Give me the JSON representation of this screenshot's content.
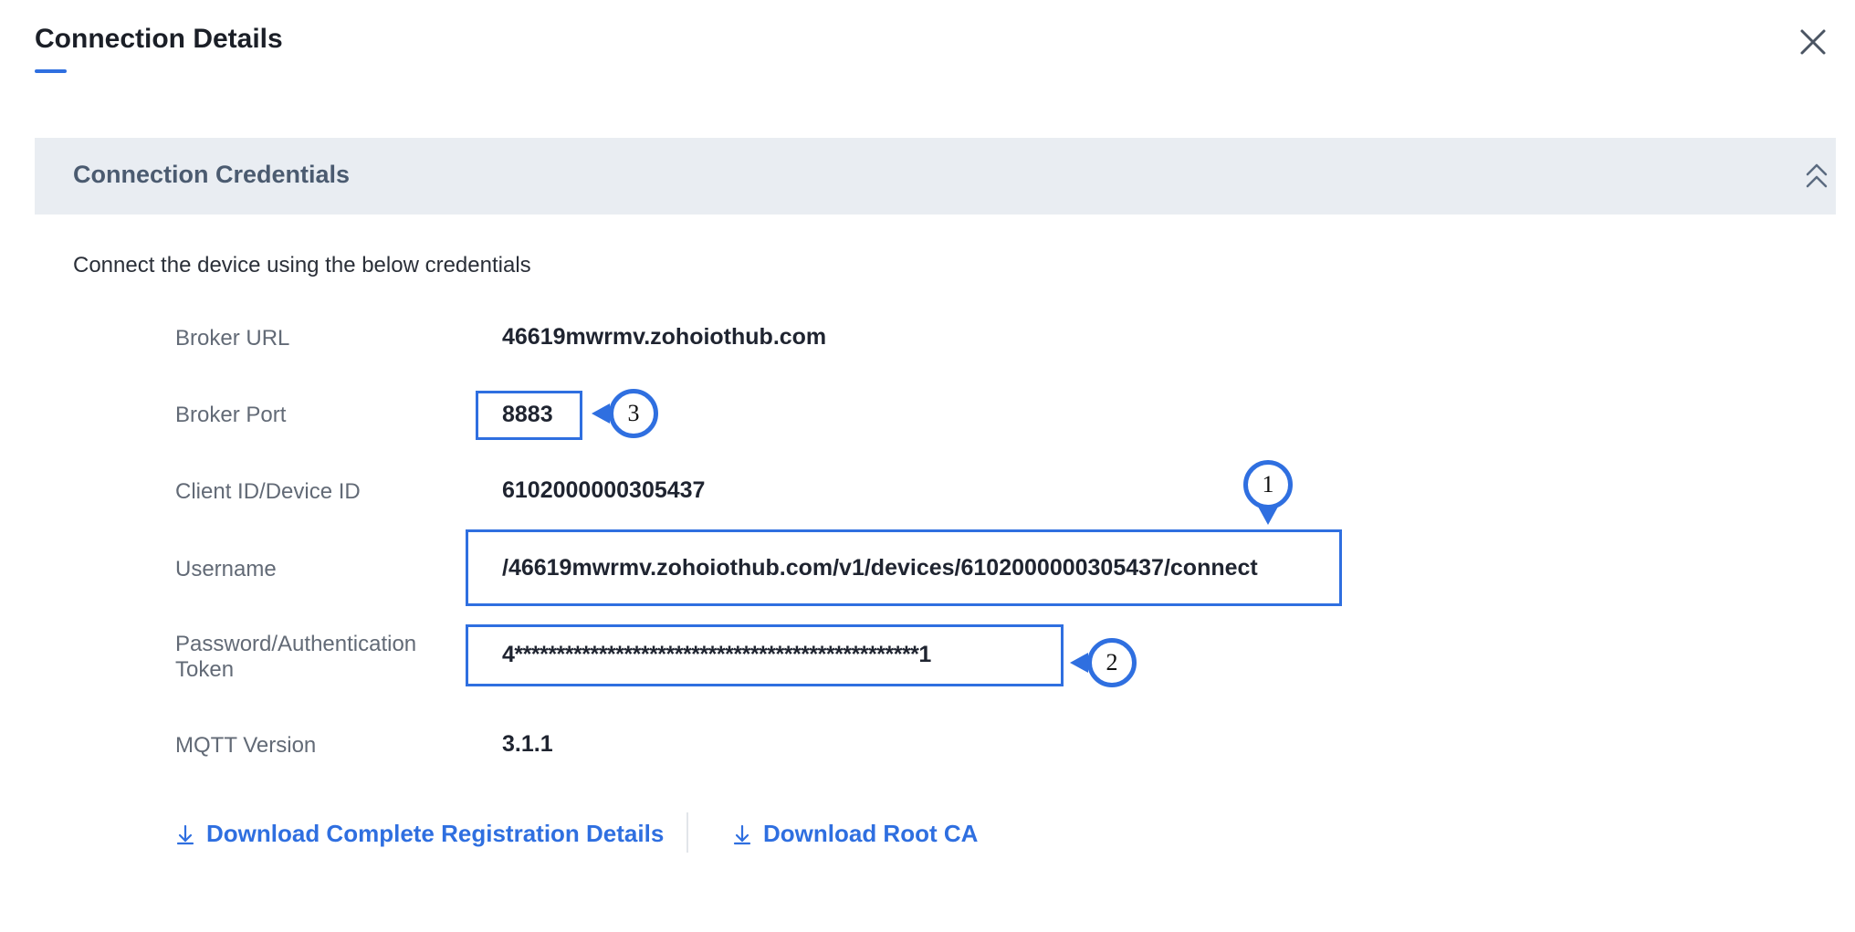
{
  "dialog": {
    "title": "Connection Details",
    "accent_color": "#2f6fe0",
    "close_icon": "close-icon"
  },
  "section": {
    "title": "Connection Credentials",
    "collapse_icon": "double-chevron-up-icon",
    "intro": "Connect the device using the below credentials"
  },
  "fields": {
    "broker_url": {
      "label": "Broker URL",
      "value": "46619mwrmv.zohoiothub.com"
    },
    "broker_port": {
      "label": "Broker Port",
      "value": "8883"
    },
    "client_id": {
      "label": "Client ID/Device ID",
      "value": "6102000000305437"
    },
    "username": {
      "label": "Username",
      "value": "/46619mwrmv.zohoiothub.com/v1/devices/6102000000305437/connect"
    },
    "password": {
      "label_line1": "Password/Authentication",
      "label_line2": "Token",
      "value": "4************************************************1"
    },
    "mqtt_version": {
      "label": "MQTT Version",
      "value": "3.1.1"
    }
  },
  "callouts": {
    "username": "1",
    "password": "2",
    "port": "3"
  },
  "links": {
    "download_registration": "Download Complete Registration Details",
    "download_root_ca": "Download Root CA",
    "icon": "download-icon"
  }
}
